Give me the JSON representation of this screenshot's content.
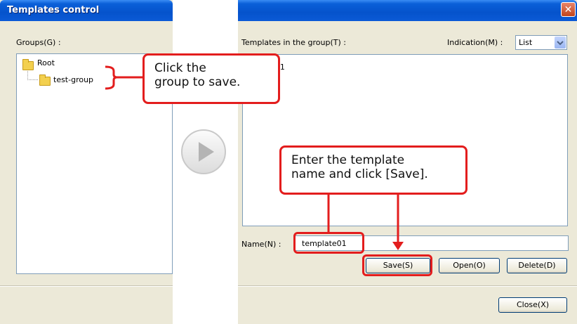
{
  "left_window": {
    "title": "Templates control",
    "groups_label": "Groups(G) :",
    "tree": {
      "root": "Root",
      "child": "test-group"
    }
  },
  "right_window": {
    "close_icon": "✕",
    "templates_label": "Templates in the group(T) :",
    "indication_label": "Indication(M) :",
    "indication_value": "List",
    "list_items": [
      "template01"
    ],
    "visible_item_text": "late01",
    "name_label": "Name(N) :",
    "name_value": "template01",
    "buttons": {
      "save": "Save(S)",
      "open": "Open(O)",
      "delete": "Delete(D)",
      "close": "Close(X)"
    }
  },
  "callouts": {
    "group": "Click the\ngroup to save.",
    "save": "Enter the template\nname and click [Save]."
  },
  "icons": {
    "play": "play-icon",
    "folder": "folder-icon",
    "dropdown": "chevron-down-icon"
  },
  "colors": {
    "accent": "#e31d1d",
    "titlebar": "#0553cc",
    "dialog_bg": "#ece9d8"
  }
}
